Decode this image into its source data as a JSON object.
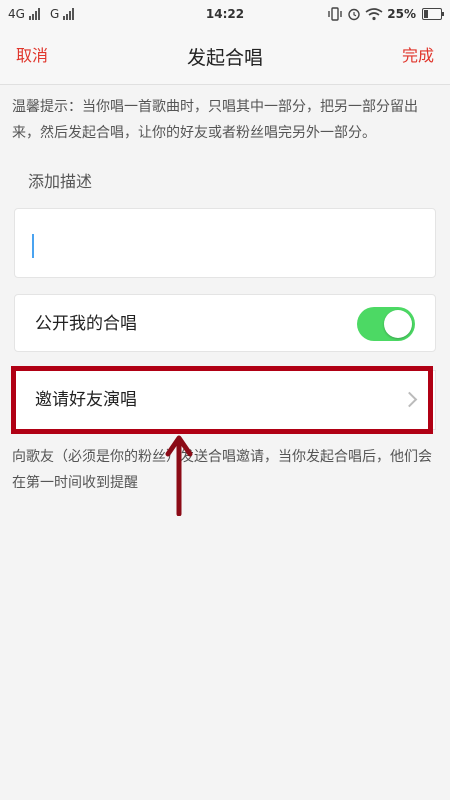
{
  "status_bar": {
    "network_1": "4G",
    "network_2": "G",
    "time": "14:22",
    "battery_text": "25%",
    "battery_level": 0.25
  },
  "nav": {
    "cancel_label": "取消",
    "title": "发起合唱",
    "done_label": "完成"
  },
  "tip_text": "温馨提示：当你唱一首歌曲时，只唱其中一部分，把另一部分留出来，然后发起合唱，让你的好友或者粉丝唱完另外一部分。",
  "description": {
    "label": "添加描述",
    "value": "",
    "placeholder": ""
  },
  "public_setting": {
    "label": "公开我的合唱",
    "enabled": true
  },
  "invite": {
    "label": "邀请好友演唱",
    "note": "向歌友（必须是你的粉丝）发送合唱邀请，当你发起合唱后，他们会在第一时间收到提醒"
  },
  "icons": {
    "signal": "signal-bars-icon",
    "vibrate": "vibrate-icon",
    "alarm": "alarm-clock-icon",
    "wifi": "wifi-icon",
    "battery": "battery-icon",
    "chevron": "chevron-right-icon",
    "arrow": "arrow-up-annotation-icon"
  },
  "colors": {
    "accent": "#e0352b",
    "toggle_on": "#4cd964",
    "highlight": "#b00014",
    "arrow": "#8b0a16"
  }
}
